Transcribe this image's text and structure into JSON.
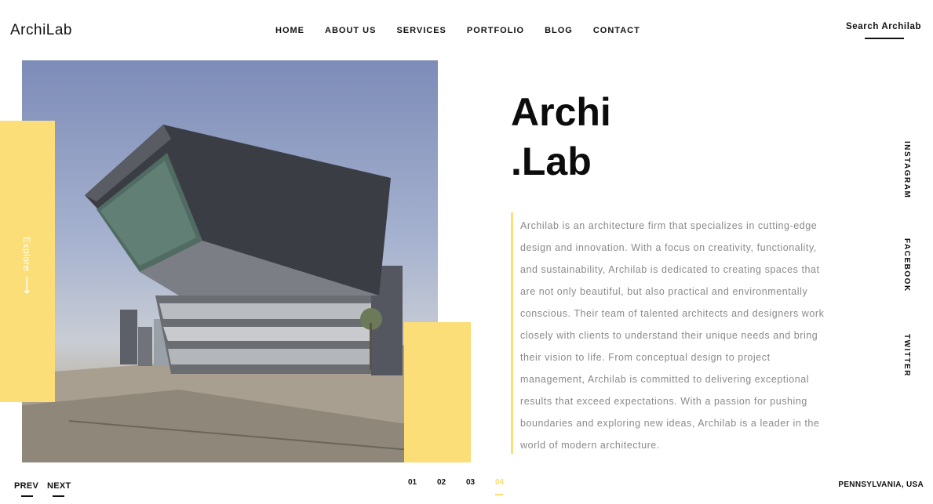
{
  "brand": {
    "logo": "ArchiLab"
  },
  "nav": {
    "items": [
      {
        "label": "HOME"
      },
      {
        "label": "ABOUT US"
      },
      {
        "label": "SERVICES"
      },
      {
        "label": "PORTFOLIO"
      },
      {
        "label": "BLOG"
      },
      {
        "label": "CONTACT"
      }
    ]
  },
  "search": {
    "label": "Search Archilab"
  },
  "hero": {
    "image_alt": "modern-building-photo",
    "explore_label": "Explore",
    "explore_icon": "arrow-right-icon"
  },
  "content": {
    "title_line1": "Archi",
    "title_line2": ".Lab",
    "description": "Archilab is an architecture firm that specializes in cutting-edge design and innovation. With a focus on creativity, functionality, and sustainability, Archilab is dedicated to creating spaces that are not only beautiful, but also practical and environmentally conscious. Their team of talented architects and designers work closely with clients to understand their unique needs and bring their vision to life. From conceptual design to project management, Archilab is committed to delivering exceptional results that exceed expectations. With a passion for pushing boundaries and exploring new ideas, Archilab is a leader in the world of modern architecture."
  },
  "social": {
    "instagram": "INSTAGRAM",
    "facebook": "FACEBOOK",
    "twitter": "TWITTER"
  },
  "pager": {
    "prev": "PREV",
    "next": "NEXT",
    "pages": [
      "01",
      "02",
      "03",
      "04"
    ],
    "active_page": "04"
  },
  "footer": {
    "location": "PENNSYLVANIA, USA"
  },
  "colors": {
    "accent": "#fbde77",
    "text": "#111111",
    "muted": "#8a8a8a"
  }
}
